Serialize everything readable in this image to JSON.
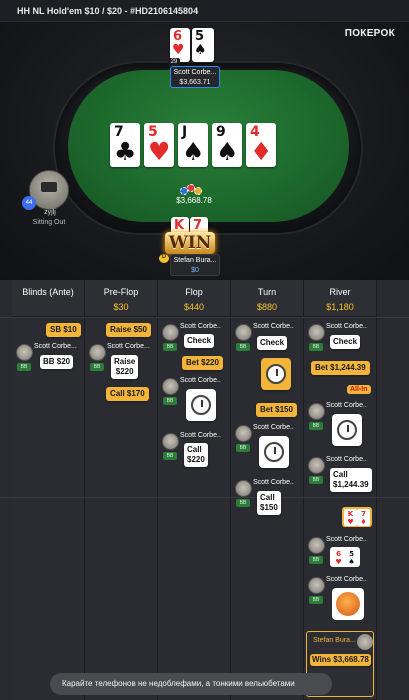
{
  "header": {
    "title": "HH NL Hold'em $10 / $20 - #HD2106145804",
    "brand": "ПОКЕРОК"
  },
  "table": {
    "board": [
      {
        "rank": "7",
        "suit": "♣",
        "color": "blk"
      },
      {
        "rank": "5",
        "suit": "♥",
        "color": "red"
      },
      {
        "rank": "J",
        "suit": "♠",
        "color": "blk"
      },
      {
        "rank": "9",
        "suit": "♠",
        "color": "blk"
      },
      {
        "rank": "4",
        "suit": "♦",
        "color": "red"
      }
    ],
    "pot": "$3,668.78",
    "top_player": {
      "name": "Scott Corbe...",
      "stack": "$3,663.71",
      "level": "29",
      "hole": [
        {
          "rank": "6",
          "suit": "♥",
          "color": "red"
        },
        {
          "rank": "5",
          "suit": "♠",
          "color": "blk"
        }
      ]
    },
    "left_player": {
      "name": "zyjlj",
      "status": "Sitting Out",
      "level": "44"
    },
    "bottom_player": {
      "name": "Stefan Bura...",
      "stack": "$0",
      "win": "WIN",
      "hole": [
        {
          "rank": "K",
          "suit": "♥",
          "color": "red"
        },
        {
          "rank": "7",
          "suit": "♦",
          "color": "red"
        }
      ]
    }
  },
  "streets": [
    {
      "name": "Blinds (Ante)",
      "amount": ""
    },
    {
      "name": "Pre-Flop",
      "amount": "$30"
    },
    {
      "name": "Flop",
      "amount": "$440"
    },
    {
      "name": "Turn",
      "amount": "$880"
    },
    {
      "name": "River",
      "amount": "$1,180"
    }
  ],
  "actions": {
    "sb": "SB $10",
    "bb": "BB $20",
    "raise50": "Raise $50",
    "raise220_1": "Raise",
    "raise220_2": "$220",
    "call170": "Call $170",
    "check": "Check",
    "bet220": "Bet $220",
    "call220_1": "Call",
    "call220_2": "$220",
    "bet150": "Bet $150",
    "call150_1": "Call",
    "call150_2": "$150",
    "bet1244": "Bet $1,244.39",
    "allin": "All-In",
    "call1244_1": "Call",
    "call1244_2": "$1,244.39",
    "wins": "Wins $3,668.78"
  },
  "player_short": "Scott Corbe...",
  "player_short2": "Scott Corbe..",
  "winner_short": "Stefan Bura...",
  "bb_tag": "BB",
  "toast": "Карайте телефонов не недоблефами, а тонкими вельюбетами"
}
